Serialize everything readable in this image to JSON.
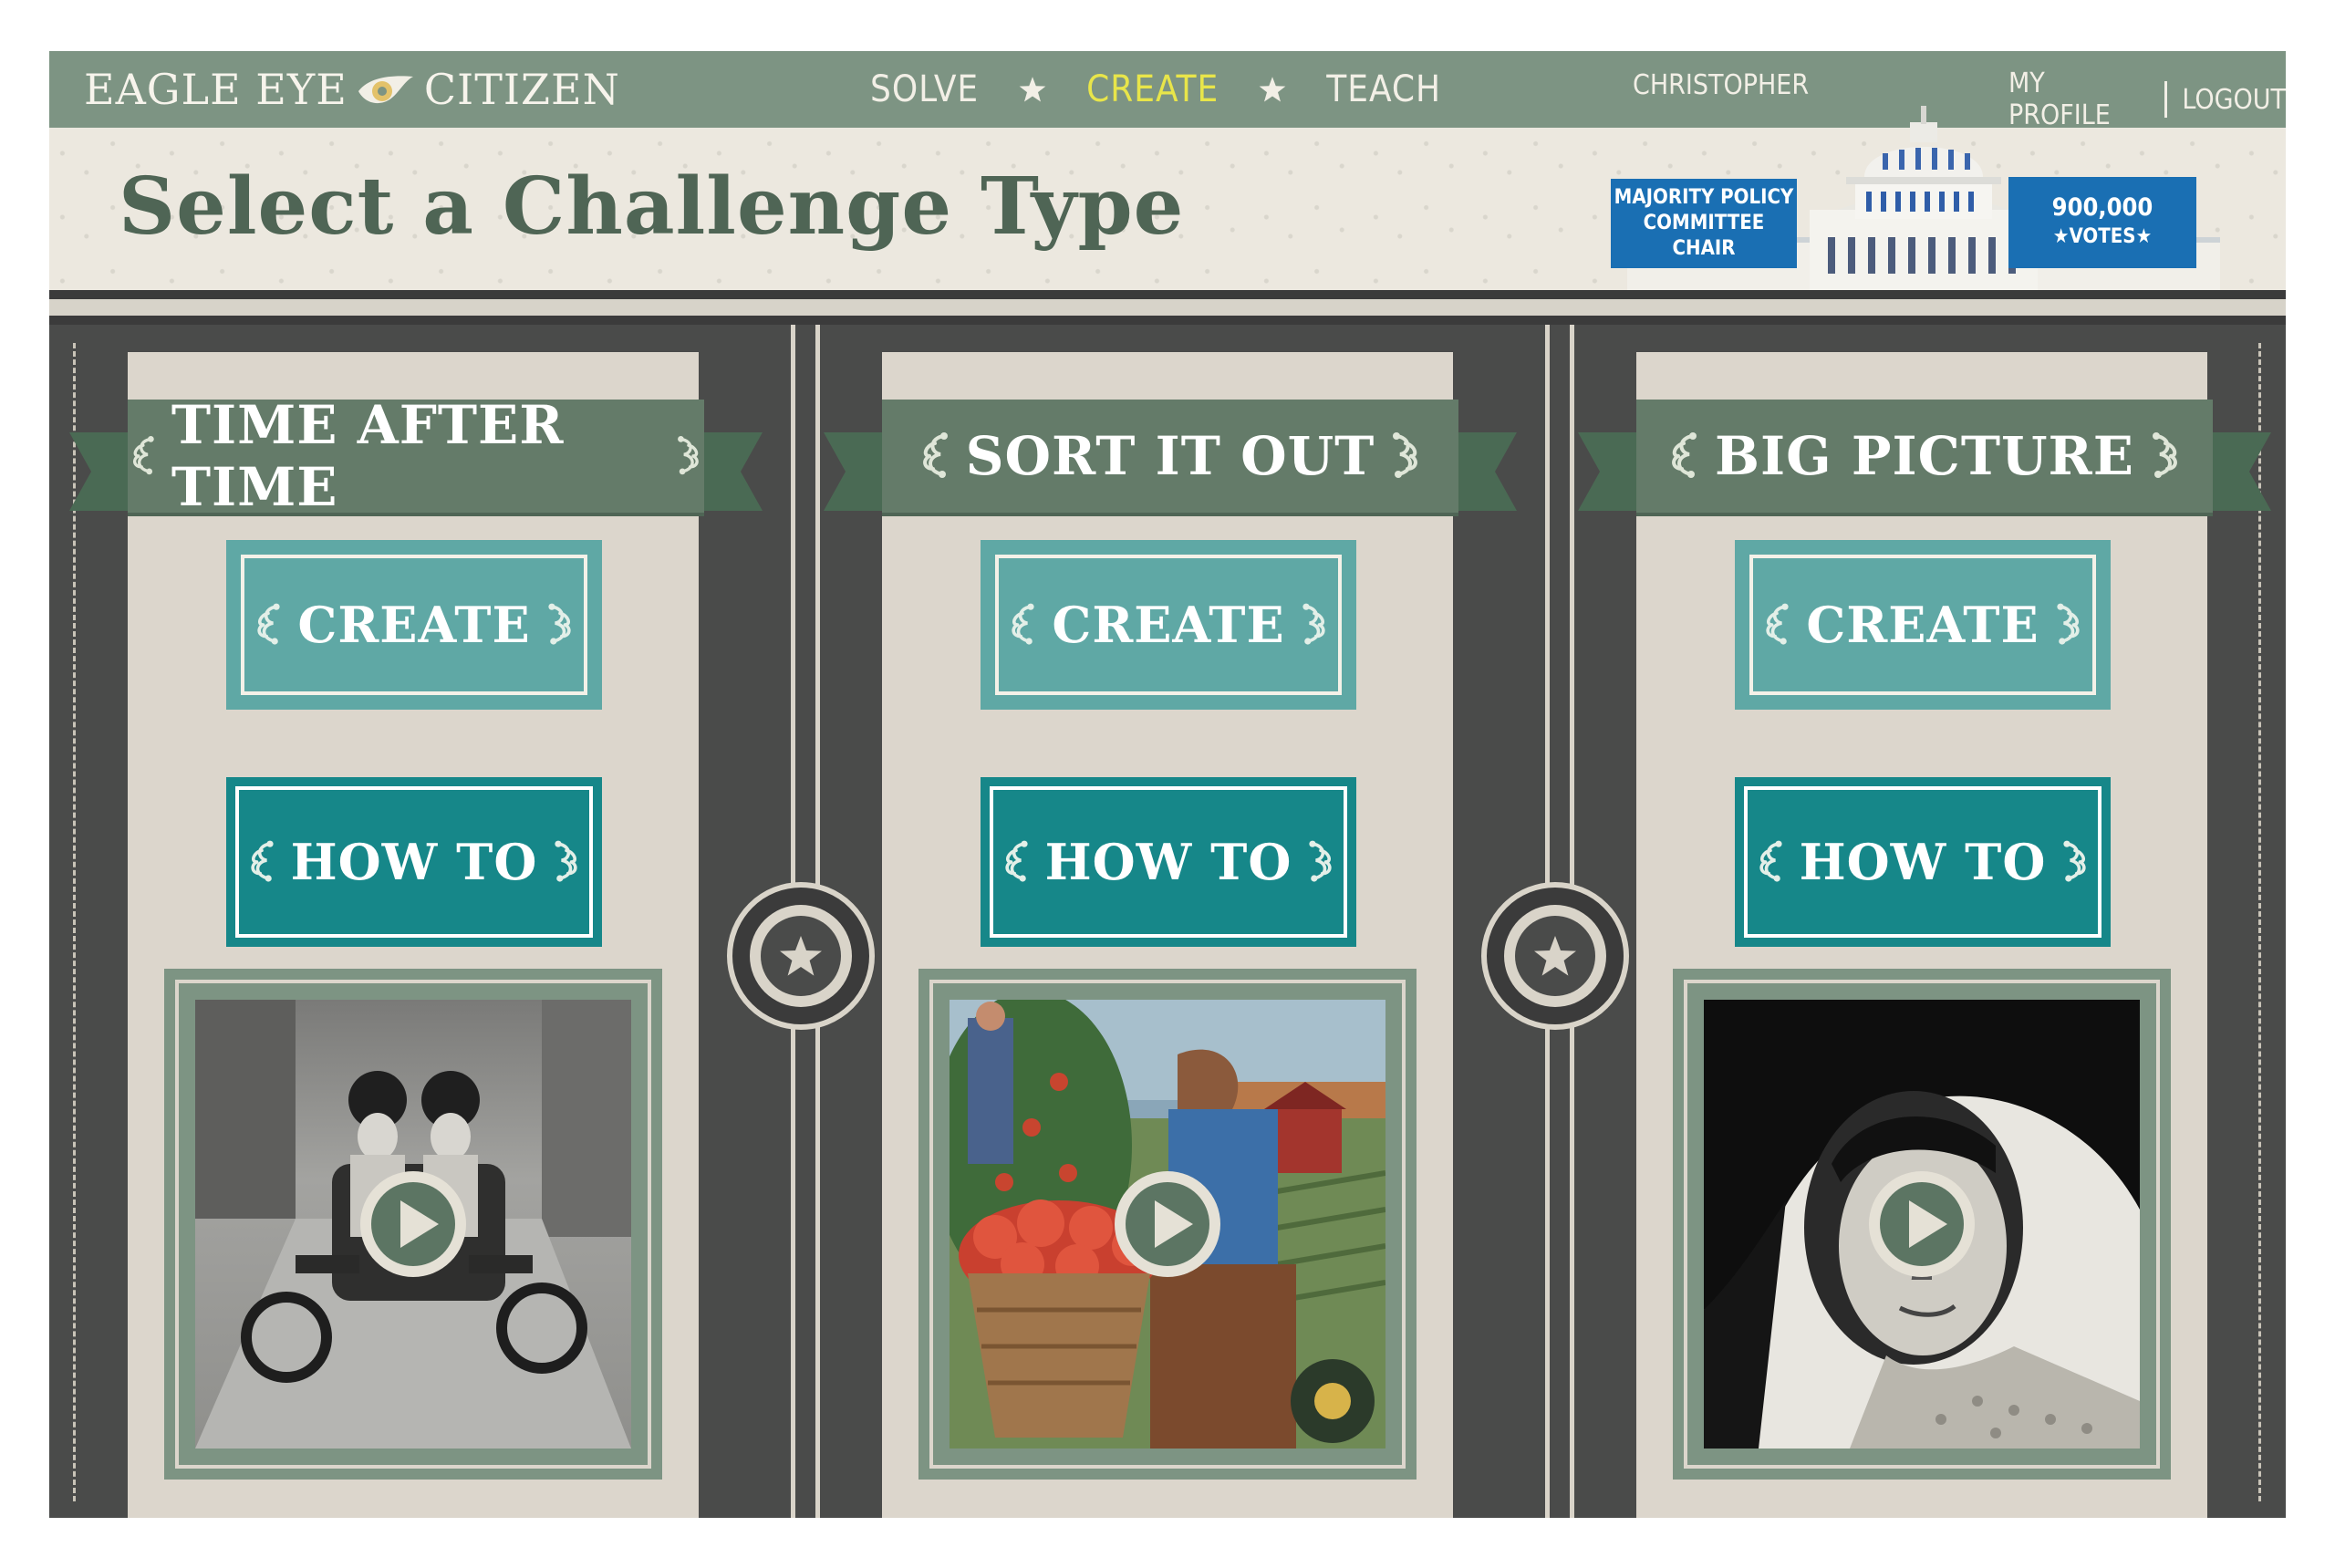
{
  "nav": {
    "logo_left": "EAGLE EYE",
    "logo_right": "CITIZEN",
    "links": [
      "SOLVE",
      "CREATE",
      "TEACH"
    ],
    "active_link": "CREATE",
    "user_name": "CHRISTOPHER",
    "my_profile": "MY PROFILE",
    "logout": "LOGOUT"
  },
  "header": {
    "title": "Select a Challenge Type",
    "rank_badge": [
      "MAJORITY POLICY",
      "COMMITTEE CHAIR"
    ],
    "votes_value": "900,000",
    "votes_label": "VOTES"
  },
  "challenges": [
    {
      "title": "TIME AFTER TIME",
      "create_label": "CREATE",
      "howto_label": "HOW TO",
      "video_icon": "play-icon"
    },
    {
      "title": "SORT IT OUT",
      "create_label": "CREATE",
      "howto_label": "HOW TO",
      "video_icon": "play-icon"
    },
    {
      "title": "BIG PICTURE",
      "create_label": "CREATE",
      "howto_label": "HOW TO",
      "video_icon": "play-icon"
    }
  ],
  "colors": {
    "nav_bg": "#7d9483",
    "active_link": "#e8e54a",
    "title": "#4f6555",
    "banner": "#647b69",
    "create_button": "#5fa8a5",
    "howto_button": "#168789",
    "badge": "#1a6fb3",
    "background": "#4a4b4a"
  }
}
